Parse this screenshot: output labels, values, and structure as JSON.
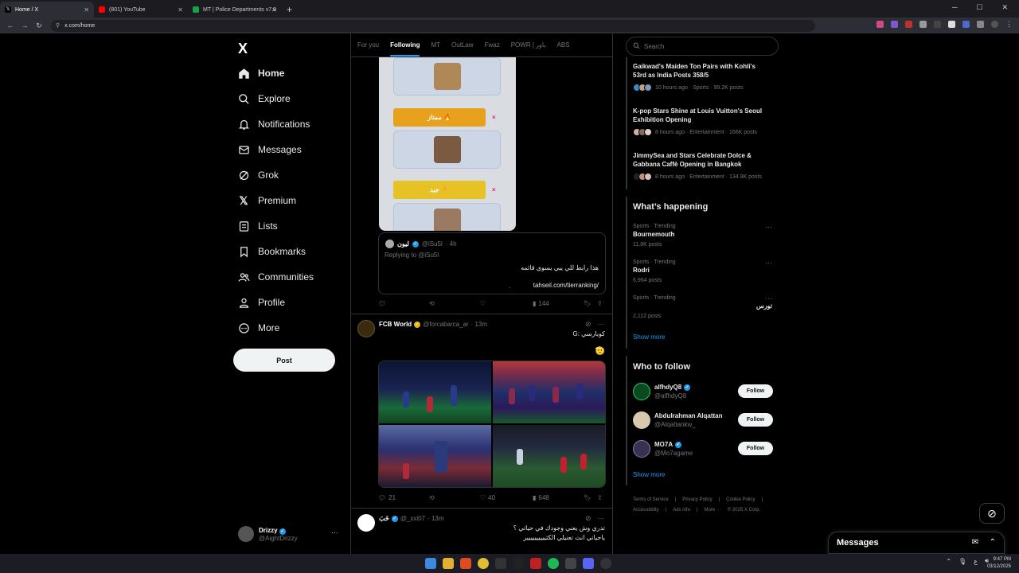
{
  "browser": {
    "tabs": [
      {
        "title": "Home / X",
        "active": true
      },
      {
        "title": "(801) YouTube",
        "active": false
      },
      {
        "title": "MT | Police Departments v7.0",
        "active": false
      }
    ],
    "url": "x.com/home"
  },
  "nav": {
    "logo": "X",
    "items": [
      {
        "label": "Home",
        "icon": "home-icon"
      },
      {
        "label": "Explore",
        "icon": "search-icon"
      },
      {
        "label": "Notifications",
        "icon": "bell-icon"
      },
      {
        "label": "Messages",
        "icon": "envelope-icon"
      },
      {
        "label": "Grok",
        "icon": "grok-icon"
      },
      {
        "label": "Premium",
        "icon": "x-icon"
      },
      {
        "label": "Lists",
        "icon": "list-icon"
      },
      {
        "label": "Bookmarks",
        "icon": "bookmark-icon"
      },
      {
        "label": "Communities",
        "icon": "people-icon"
      },
      {
        "label": "Profile",
        "icon": "person-icon"
      },
      {
        "label": "More",
        "icon": "more-circle-icon"
      }
    ],
    "post_label": "Post",
    "account": {
      "name": "Drizzy",
      "handle": "@AightDrizzy"
    }
  },
  "timeline": {
    "tabs": [
      "For you",
      "Following",
      "MT",
      "OutLaw",
      "Fwaz",
      "POWR | باور",
      "ABS"
    ],
    "tier_image": {
      "buttons": [
        "ممتاز 🔥",
        "جيد 👌"
      ],
      "remove": "×"
    },
    "quote": {
      "name": "ليون",
      "handle": "@iSu5l",
      "time": "· 4h",
      "replying": "Replying to @iSu5l",
      "text": "هذا رابط للي يبي يسوي قائمه",
      "link": "tahseil.com/tierranking/",
      "dot": "."
    },
    "post1_stats": {
      "views": "144"
    },
    "post2": {
      "name": "FCB World",
      "handle": "@forcabarca_ar",
      "time": "· 13m",
      "text": "كوبارسي :G",
      "emoji": "🫡",
      "replies": "21",
      "likes": "40",
      "views": "648"
    },
    "post3": {
      "name": "خَبَ",
      "handle": "@_xxi07",
      "time": "· 13m",
      "line1": "تدري وش يعني وجودك في حياتي ؟",
      "line2": "ياحياتي انت تعنيلي الكثيييييييييير"
    }
  },
  "right": {
    "search_placeholder": "Search",
    "news": [
      {
        "title": "Gaikwad's Maiden Ton Pairs with Kohli's 53rd as India Posts 358/5",
        "meta": "10 hours ago · Sports · 99.2K posts"
      },
      {
        "title": "K-pop Stars Shine at Louis Vuitton's Seoul Exhibition Opening",
        "meta": "8 hours ago · Entertainment · 166K posts"
      },
      {
        "title": "JimmySea and Stars Celebrate Dolce & Gabbana Caffè Opening in Bangkok",
        "meta": "8 hours ago · Entertainment · 134.9K posts"
      }
    ],
    "happening_title": "What’s happening",
    "trends": [
      {
        "category": "Sports · Trending",
        "name": "Bournemouth",
        "count": "11.8K posts"
      },
      {
        "category": "Sports · Trending",
        "name": "Rodri",
        "count": "6,964 posts"
      },
      {
        "category": "Sports · Trending",
        "name": "تورس",
        "count": "2,112 posts"
      }
    ],
    "show_more": "Show more",
    "who_title": "Who to follow",
    "follow_label": "Follow",
    "who": [
      {
        "name": "alfhdyQ8",
        "handle": "@alfhdyQ8"
      },
      {
        "name": "Abdulrahman Alqattan",
        "handle": "@Alqattankw_"
      },
      {
        "name": "MO7A",
        "handle": "@Mo7agame"
      }
    ],
    "footer": [
      "Terms of Service",
      "|",
      "Privacy Policy",
      "|",
      "Cookie Policy",
      "|",
      "Accessibility",
      "|",
      "Ads info",
      "|",
      "More ···",
      "© 2025 X Corp."
    ],
    "messages_title": "Messages"
  },
  "taskbar": {
    "time": "9:47 PM",
    "date": "03/12/2025",
    "lang": "ع"
  },
  "colors": {
    "accent": "#1d9bf0",
    "background": "#000000",
    "border": "#2f3336",
    "tier_excellent": "#f0a020",
    "tier_good": "#e8c020"
  }
}
